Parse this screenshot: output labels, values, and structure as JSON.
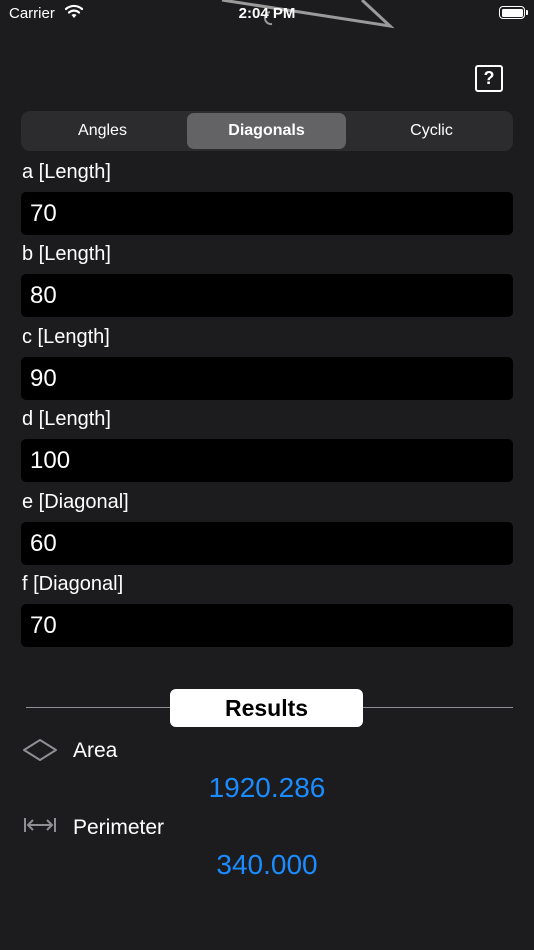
{
  "status_bar": {
    "carrier": "Carrier",
    "time": "2:04 PM"
  },
  "header": {
    "help_label": "?"
  },
  "tabs": [
    {
      "label": "Angles",
      "active": false
    },
    {
      "label": "Diagonals",
      "active": true
    },
    {
      "label": "Cyclic",
      "active": false
    }
  ],
  "fields": [
    {
      "label": "a [Length]",
      "value": "70"
    },
    {
      "label": "b [Length]",
      "value": "80"
    },
    {
      "label": "c [Length]",
      "value": "90"
    },
    {
      "label": "d [Length]",
      "value": "100"
    },
    {
      "label": "e [Diagonal]",
      "value": "60"
    },
    {
      "label": "f [Diagonal]",
      "value": "70"
    }
  ],
  "results": {
    "button_label": "Results",
    "area": {
      "label": "Area",
      "value": "1920.286",
      "icon": "rhombus-icon"
    },
    "perimeter": {
      "label": "Perimeter",
      "value": "340.000",
      "icon": "width-arrows-icon"
    }
  },
  "colors": {
    "background": "#1c1c1e",
    "field": "#000000",
    "accent": "#1a8cff",
    "segment_active": "#636366"
  }
}
